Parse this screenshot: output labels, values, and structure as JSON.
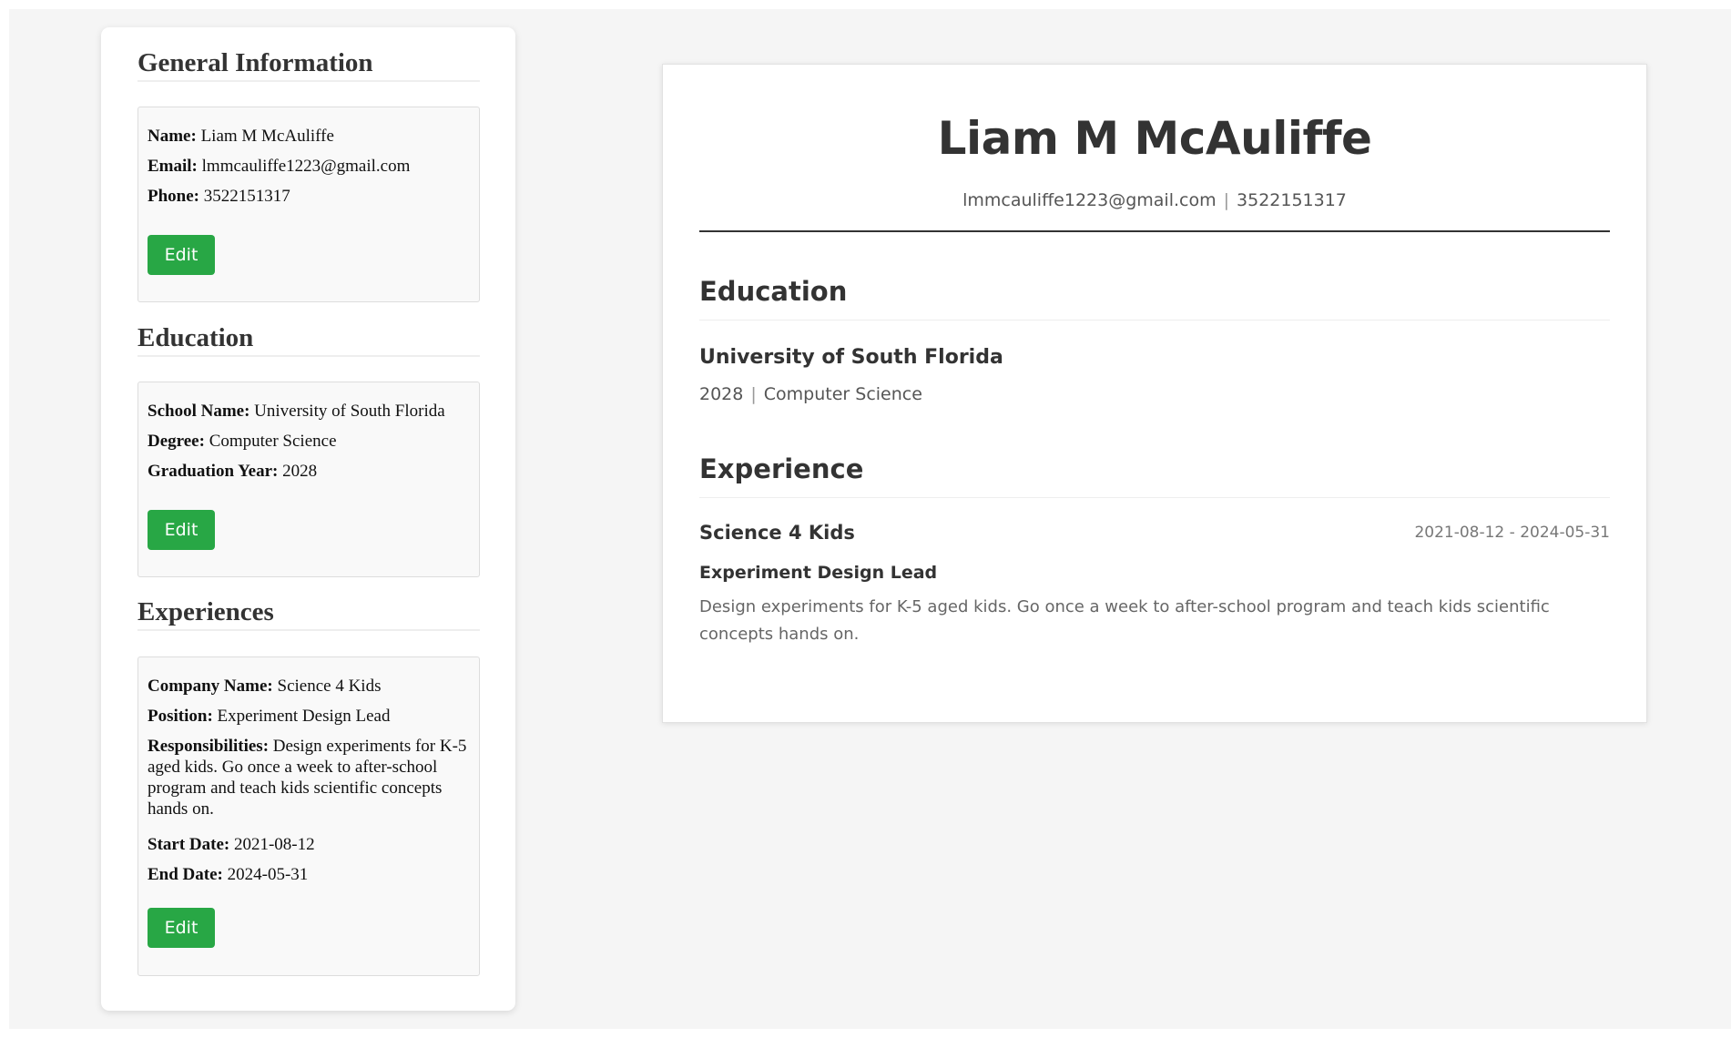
{
  "general": {
    "section_title": "General Information",
    "name_label": "Name:",
    "name_value": "Liam M McAuliffe",
    "email_label": "Email:",
    "email_value": "lmmcauliffe1223@gmail.com",
    "phone_label": "Phone:",
    "phone_value": "3522151317",
    "edit_label": "Edit"
  },
  "education": {
    "section_title": "Education",
    "school_label": "School Name:",
    "school_value": "University of South Florida",
    "degree_label": "Degree:",
    "degree_value": "Computer Science",
    "year_label": "Graduation Year:",
    "year_value": "2028",
    "edit_label": "Edit"
  },
  "experiences": {
    "section_title": "Experiences",
    "company_label": "Company Name:",
    "company_value": "Science 4 Kids",
    "position_label": "Position:",
    "position_value": "Experiment Design Lead",
    "resp_label": "Responsibilities:",
    "resp_value": "Design experiments for K-5 aged kids. Go once a week to after-school program and teach kids scientific concepts hands on.",
    "start_label": "Start Date:",
    "start_value": "2021-08-12",
    "end_label": "End Date:",
    "end_value": "2024-05-31",
    "edit_label": "Edit"
  },
  "preview": {
    "name": "Liam M McAuliffe",
    "email": "lmmcauliffe1223@gmail.com",
    "separator": "|",
    "phone": "3522151317",
    "education_title": "Education",
    "school": "University of South Florida",
    "year": "2028",
    "degree": "Computer Science",
    "experience_title": "Experience",
    "company": "Science 4 Kids",
    "dates": "2021-08-12 - 2024-05-31",
    "position": "Experiment Design Lead",
    "responsibilities": "Design experiments for K-5 aged kids. Go once a week to after-school program and teach kids scientific concepts hands on."
  },
  "colors": {
    "accent_green": "#28a745",
    "page_background": "#f5f5f5",
    "text_dark": "#333333"
  }
}
